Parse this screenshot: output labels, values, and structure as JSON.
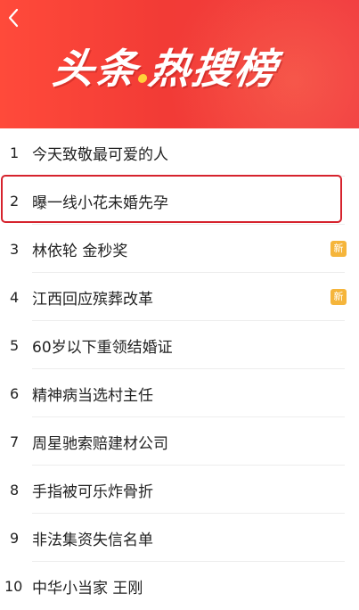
{
  "header": {
    "back_icon": "chevron-left-icon",
    "title_part1": "头条",
    "title_part2": "热搜榜",
    "accent_color": "#f23b36",
    "dot_color": "#ffd23a"
  },
  "list": {
    "badge_color": "#f5b53b",
    "highlight_color": "#d6232d",
    "items": [
      {
        "rank": "1",
        "title": "今天致敬最可爱的人",
        "badge": ""
      },
      {
        "rank": "2",
        "title": "曝一线小花未婚先孕",
        "badge": ""
      },
      {
        "rank": "3",
        "title": "林依轮 金秒奖",
        "badge": "新"
      },
      {
        "rank": "4",
        "title": "江西回应殡葬改革",
        "badge": "新"
      },
      {
        "rank": "5",
        "title": "60岁以下重领结婚证",
        "badge": ""
      },
      {
        "rank": "6",
        "title": "精神病当选村主任",
        "badge": ""
      },
      {
        "rank": "7",
        "title": "周星驰索赔建材公司",
        "badge": ""
      },
      {
        "rank": "8",
        "title": "手指被可乐炸骨折",
        "badge": ""
      },
      {
        "rank": "9",
        "title": "非法集资失信名单",
        "badge": ""
      },
      {
        "rank": "10",
        "title": "中华小当家 王刚",
        "badge": ""
      }
    ]
  }
}
